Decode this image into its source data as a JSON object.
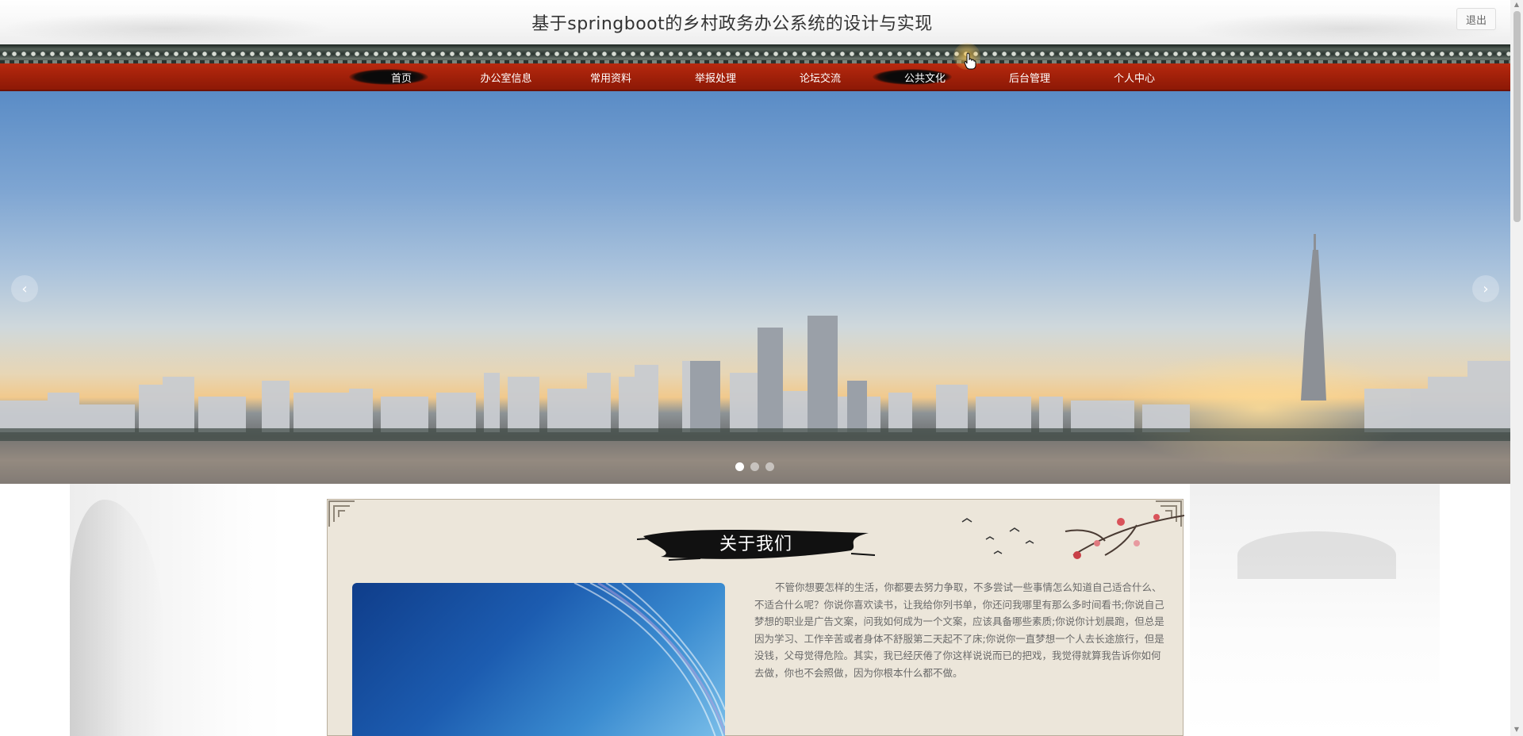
{
  "header": {
    "title": "基于springboot的乡村政务办公系统的设计与实现",
    "logout_label": "退出"
  },
  "nav": {
    "items": [
      {
        "label": "首页",
        "active": true
      },
      {
        "label": "办公室信息",
        "active": false
      },
      {
        "label": "常用资料",
        "active": false
      },
      {
        "label": "举报处理",
        "active": false
      },
      {
        "label": "论坛交流",
        "active": false
      },
      {
        "label": "公共文化",
        "active": true
      },
      {
        "label": "后台管理",
        "active": false
      },
      {
        "label": "个人中心",
        "active": false
      }
    ]
  },
  "carousel": {
    "prev_icon": "‹",
    "next_icon": "›",
    "slide_count": 3,
    "current_slide": 1
  },
  "about": {
    "title": "关于我们",
    "text": "不管你想要怎样的生活，你都要去努力争取，不多尝试一些事情怎么知道自己适合什么、不适合什么呢？你说你喜欢读书，让我给你列书单，你还问我哪里有那么多时间看书;你说自己梦想的职业是广告文案，问我如何成为一个文案，应该具备哪些素质;你说你计划晨跑，但总是因为学习、工作辛苦或者身体不舒服第二天起不了床;你说你一直梦想一个人去长途旅行，但是没钱，父母觉得危险。其实，我已经厌倦了你这样说说而已的把戏，我觉得就算我告诉你如何去做，你也不会照做，因为你根本什么都不做。"
  },
  "colors": {
    "nav_red": "#a3210a",
    "panel_bg": "#ece6da",
    "title_text": "#333333"
  }
}
